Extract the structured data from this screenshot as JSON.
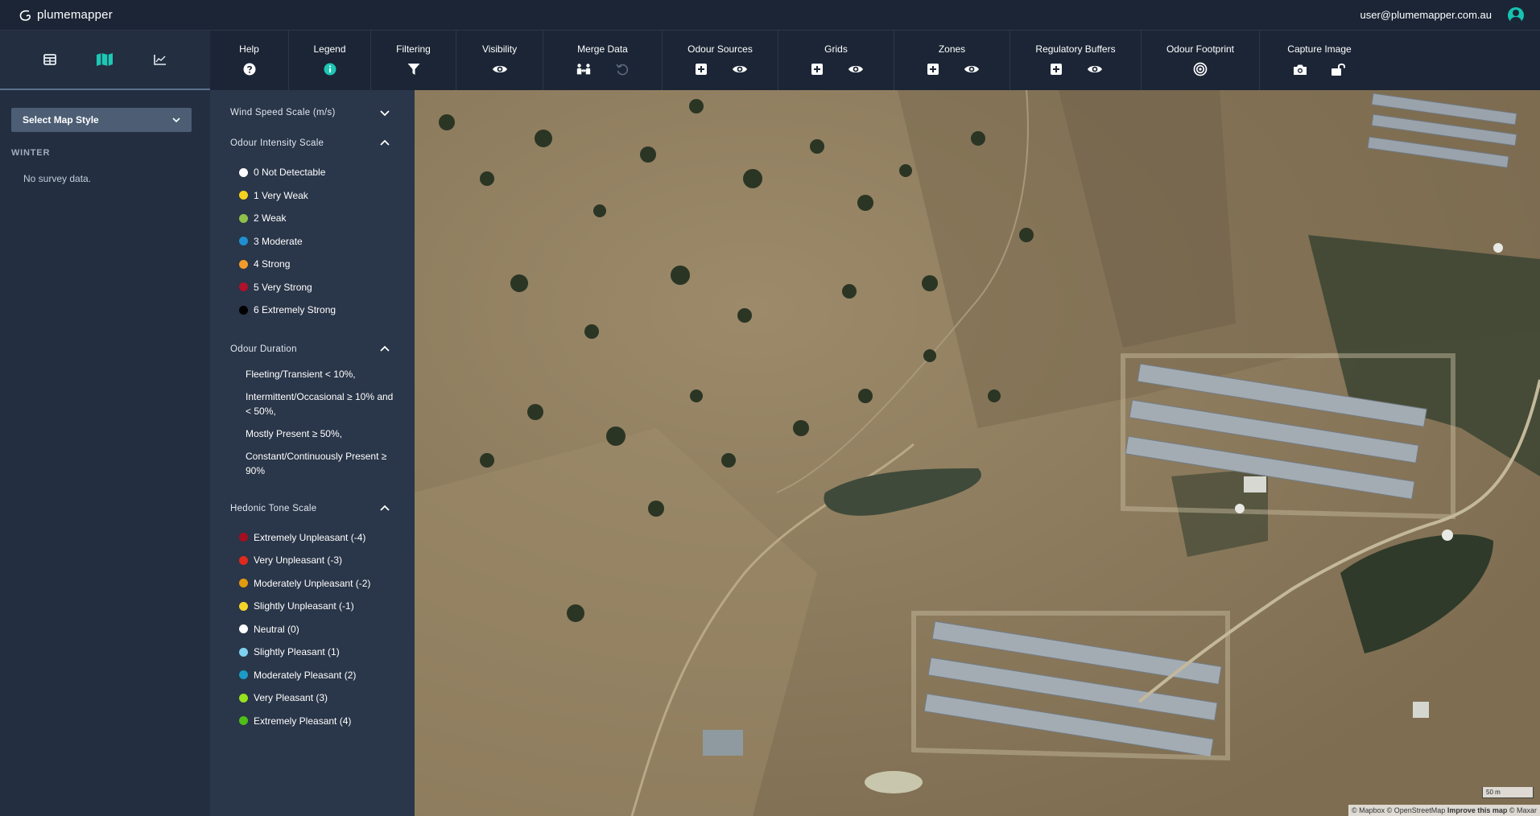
{
  "app": {
    "logo_text": "plumemapper",
    "user_email": "user@plumemapper.com.au"
  },
  "left_panel": {
    "view_tabs": [
      {
        "name": "table-view",
        "icon": "table-icon"
      },
      {
        "name": "map-view",
        "icon": "map-icon"
      },
      {
        "name": "chart-view",
        "icon": "chart-icon"
      }
    ],
    "map_style_placeholder": "Select Map Style",
    "season": "WINTER",
    "empty_text": "No survey data."
  },
  "toolbar": {
    "help": "Help",
    "legend": "Legend",
    "filtering": "Filtering",
    "visibility": "Visibility",
    "merge_data": "Merge Data",
    "odour_sources": "Odour Sources",
    "grids": "Grids",
    "zones": "Zones",
    "regulatory_buffers": "Regulatory Buffers",
    "odour_footprint": "Odour Footprint",
    "capture_image": "Capture Image"
  },
  "legend": {
    "wind_title": "Wind Speed Scale (m/s)",
    "intensity_title": "Odour Intensity Scale",
    "intensity_items": [
      {
        "label": "0 Not Detectable",
        "color": "#ffffff"
      },
      {
        "label": "1 Very Weak",
        "color": "#f4d21f"
      },
      {
        "label": "2 Weak",
        "color": "#8fc04a"
      },
      {
        "label": "3 Moderate",
        "color": "#1f8fd1"
      },
      {
        "label": "4 Strong",
        "color": "#f39a2c"
      },
      {
        "label": "5 Very Strong",
        "color": "#b0112c"
      },
      {
        "label": "6 Extremely Strong",
        "color": "#000000"
      }
    ],
    "duration_title": "Odour Duration",
    "duration_items": [
      "Fleeting/Transient < 10%,",
      "Intermittent/Occasional ≥ 10% and < 50%,",
      "Mostly Present ≥ 50%,",
      "Constant/Continuously Present ≥ 90%"
    ],
    "hedonic_title": "Hedonic Tone Scale",
    "hedonic_items": [
      {
        "label": "Extremely Unpleasant (-4)",
        "color": "#a3101f"
      },
      {
        "label": "Very Unpleasant (-3)",
        "color": "#e02a1c"
      },
      {
        "label": "Moderately Unpleasant (-2)",
        "color": "#e39a0c"
      },
      {
        "label": "Slightly Unpleasant (-1)",
        "color": "#f6d52a"
      },
      {
        "label": "Neutral (0)",
        "color": "#ffffff"
      },
      {
        "label": "Slightly Pleasant (1)",
        "color": "#7fd2ef"
      },
      {
        "label": "Moderately Pleasant (2)",
        "color": "#1a9cc6"
      },
      {
        "label": "Very Pleasant (3)",
        "color": "#96e21e"
      },
      {
        "label": "Extremely Pleasant (4)",
        "color": "#4fbf18"
      }
    ]
  },
  "map": {
    "scale_label": "50 m",
    "attribution": "© Mapbox © OpenStreetMap",
    "improve": "Improve this map",
    "attribution_tail": "© Maxar"
  }
}
